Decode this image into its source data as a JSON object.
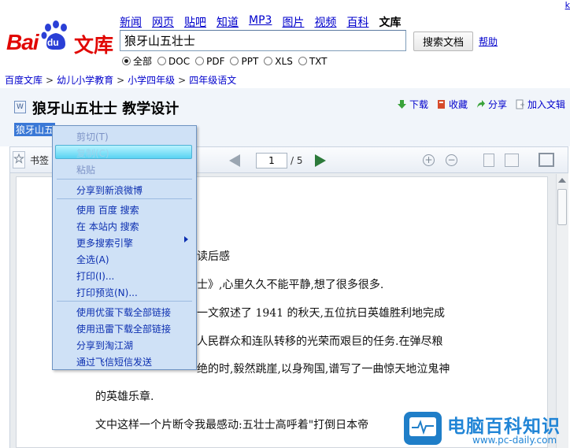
{
  "header": {
    "top_right_link": "k",
    "nav": [
      "新闻",
      "网页",
      "贴吧",
      "知道",
      "MP3",
      "图片",
      "视频",
      "百科"
    ],
    "nav_active": "文库",
    "search_value": "狼牙山五壮士",
    "search_button": "搜索文档",
    "help_link": "帮助",
    "filters": [
      {
        "label": "全部",
        "checked": true
      },
      {
        "label": "DOC",
        "checked": false
      },
      {
        "label": "PDF",
        "checked": false
      },
      {
        "label": "PPT",
        "checked": false
      },
      {
        "label": "XLS",
        "checked": false
      },
      {
        "label": "TXT",
        "checked": false
      }
    ],
    "logo": {
      "bai": "Bai",
      "du": "du",
      "wenku": "文库",
      "brand_color": "#e10602"
    }
  },
  "breadcrumb": [
    "百度文库",
    "幼儿小学教育",
    "小学四年级",
    "四年级语文"
  ],
  "document": {
    "title": "狼牙山五壮士 教学设计",
    "subtitle_link": "狼牙山五",
    "actions": [
      {
        "label": "下载",
        "icon": "download-icon"
      },
      {
        "label": "收藏",
        "icon": "bookmark-icon"
      },
      {
        "label": "分享",
        "icon": "share-icon"
      },
      {
        "label": "加入文辑",
        "icon": "add-collection-icon"
      }
    ]
  },
  "toolbar": {
    "bookmark_label": "书签",
    "current_page": "1",
    "total_pages": "/ 5"
  },
  "content_lines": [
    "读后感",
    "士》,心里久久不能平静,想了很多很多.",
    "一文叙述了 1941 的秋天,五位抗日英雄胜利地完成",
    "人民群众和连队转移的光荣而艰巨的任务.在弹尽粮",
    "绝的时,毅然跳崖,以身殉国,谱写了一曲惊天地泣鬼神",
    "的英雄乐章.",
    "文中这样一个片断令我最感动:五壮士高呼着\"打倒日本帝"
  ],
  "context_menu": {
    "items": [
      {
        "label": "剪切(T)",
        "disabled": true
      },
      {
        "label": "复制(C)",
        "disabled": false,
        "highlighted": true
      },
      {
        "label": "粘贴",
        "disabled": true
      },
      {
        "label": "分享到新浪微博",
        "disabled": false
      },
      {
        "label": "使用 百度 搜索",
        "disabled": false
      },
      {
        "label": "在 本站内 搜索",
        "disabled": false
      },
      {
        "label": "更多搜索引擎",
        "disabled": false,
        "submenu": true
      },
      {
        "label": "全选(A)",
        "disabled": false
      },
      {
        "label": "打印(I)...",
        "disabled": false
      },
      {
        "label": "打印预览(N)...",
        "disabled": false
      },
      {
        "label": "使用优蛋下载全部链接",
        "disabled": false
      },
      {
        "label": "使用迅雷下载全部链接",
        "disabled": false
      },
      {
        "label": "分享到淘江湖",
        "disabled": false
      },
      {
        "label": "通过飞信短信发送",
        "disabled": false
      }
    ]
  },
  "watermark": {
    "title": "电脑百科知识",
    "url": "www.pc-daily.com",
    "color": "#2185d6"
  }
}
